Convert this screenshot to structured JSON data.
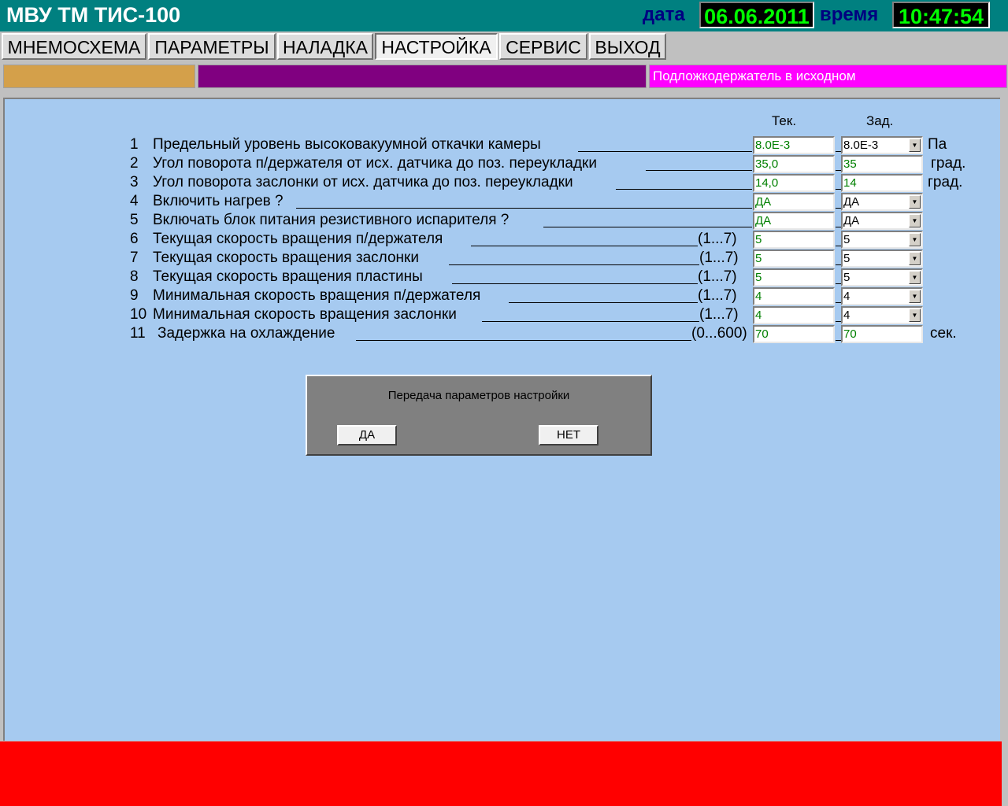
{
  "title": "МВУ ТМ ТИС-100",
  "header": {
    "date_label": "дата",
    "date_value": "06.06.2011",
    "time_label": "время",
    "time_value": "10:47:54"
  },
  "menu": [
    {
      "label": "МНЕМОСХЕМА"
    },
    {
      "label": "ПАРАМЕТРЫ"
    },
    {
      "label": "НАЛАДКА"
    },
    {
      "label": "НАСТРОЙКА",
      "active": true
    },
    {
      "label": "СЕРВИС"
    },
    {
      "label": "ВЫХОД"
    }
  ],
  "status": {
    "message": "Подложкодержатель в исходном",
    "colors": {
      "box1": "#d4a04a",
      "box2": "#800080",
      "box3": "#ff00ff"
    }
  },
  "columns": {
    "current": "Тек.",
    "set": "Зад."
  },
  "rows": [
    {
      "num": "1",
      "text": "Предельный уровень высоковакуумной откачки камеры",
      "range": "",
      "current": "8.0E-3",
      "set": "8.0E-3",
      "dropdown": true,
      "unit": "Па"
    },
    {
      "num": "2",
      "text": "Угол поворота п/держателя от исх. датчика до поз. переукладки",
      "range": "",
      "current": "35,0",
      "set": "35",
      "dropdown": false,
      "unit": "град."
    },
    {
      "num": "3",
      "text": "Угол поворота заслонки от исх. датчика до поз. переукладки",
      "range": "",
      "current": "14,0",
      "set": "14",
      "dropdown": false,
      "unit": "град."
    },
    {
      "num": "4",
      "text": "Включить нагрев ?",
      "range": "",
      "current": "ДА",
      "set": "ДА",
      "dropdown": true,
      "unit": ""
    },
    {
      "num": "5",
      "text": "Включать блок питания резистивного испарителя ?",
      "range": "",
      "current": "ДА",
      "set": "ДА",
      "dropdown": true,
      "unit": ""
    },
    {
      "num": "6",
      "text": "Текущая скорость вращения п/держателя",
      "range": "(1...7)",
      "current": "5",
      "set": "5",
      "dropdown": true,
      "unit": ""
    },
    {
      "num": "7",
      "text": "Текущая скорость вращения  заслонки",
      "range": "(1...7)",
      "current": "5",
      "set": "5",
      "dropdown": true,
      "unit": ""
    },
    {
      "num": "8",
      "text": "Текущая скорость вращения  пластины",
      "range": "(1...7)",
      "current": "5",
      "set": "5",
      "dropdown": true,
      "unit": ""
    },
    {
      "num": "9",
      "text": "Минимальная скорость вращения п/держателя",
      "range": "(1...7)",
      "current": "4",
      "set": "4",
      "dropdown": true,
      "unit": ""
    },
    {
      "num": "10",
      "text": "Минимальная скорость вращения заслонки",
      "range": "(1...7)",
      "current": "4",
      "set": "4",
      "dropdown": true,
      "unit": ""
    },
    {
      "num": "11",
      "text": "Задержка на охлаждение",
      "range": "(0...600)",
      "current": "70",
      "set": "70",
      "dropdown": false,
      "unit": "сек."
    }
  ],
  "dialog": {
    "title": "Передача параметров настройки",
    "yes": "ДА",
    "no": "НЕТ"
  }
}
